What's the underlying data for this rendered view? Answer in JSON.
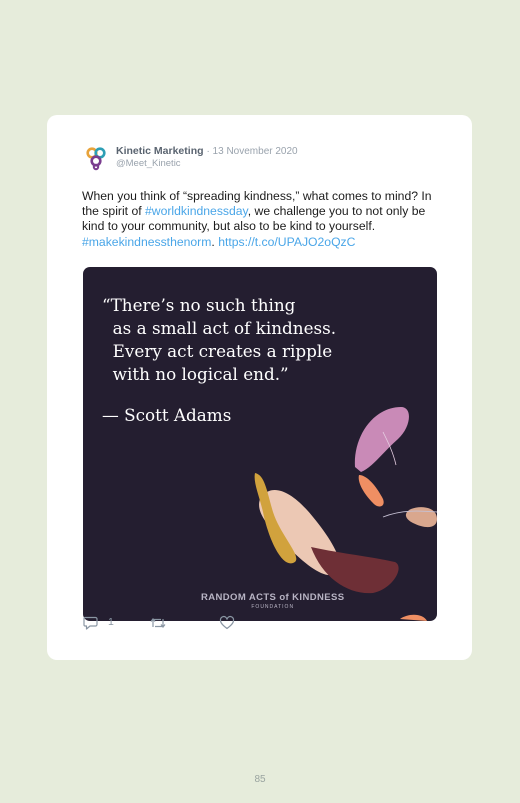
{
  "tweet": {
    "author_name": "Kinetic Marketing",
    "date": "· 13 November 2020",
    "handle": "@Meet_Kinetic",
    "text_1": "When you think of “spreading kindness,” what comes to mind? In the spirit of ",
    "hashtag_1": "#worldkindnessday",
    "text_2": ", we challenge you to not only be kind to your community, but also to be kind to yourself. ",
    "hashtag_2": "#makekindnessthenorm",
    "text_3": ". ",
    "link": "https://t.co/UPAJO2oQzC",
    "link_color": "#4aa6e8"
  },
  "image": {
    "quote": "“There’s no such thing\n  as a small act of kindness.\n  Every act creates a ripple\n  with no logical end.”",
    "author": "— Scott Adams",
    "brand": "RANDOM ACTS of KINDNESS",
    "brand_sub": "FOUNDATION",
    "background": "#241e30"
  },
  "actions": {
    "reply_count": "1",
    "reply_icon": "reply-icon",
    "retweet_icon": "retweet-icon",
    "like_icon": "heart-icon"
  },
  "page": {
    "number": "85"
  }
}
